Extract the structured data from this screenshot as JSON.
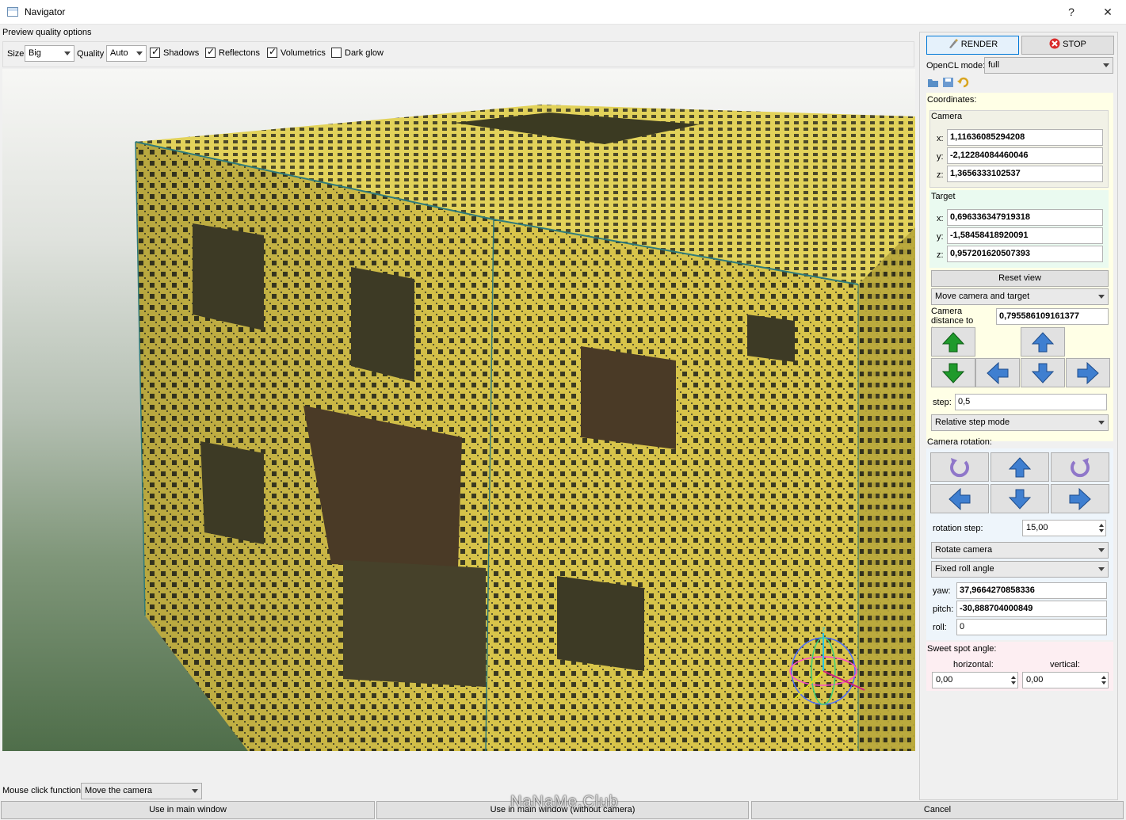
{
  "window": {
    "title": "Navigator",
    "help_label": "?",
    "close_label": "✕"
  },
  "preview": {
    "group_label": "Preview quality options",
    "size_label": "Size",
    "size_value": "Big",
    "quality_label": "Quality",
    "quality_value": "Auto",
    "shadows_label": "Shadows",
    "reflections_label": "Reflectons",
    "volumetrics_label": "Volumetrics",
    "dark_glow_label": "Dark glow",
    "shadows_checked": true,
    "reflections_checked": true,
    "volumetrics_checked": true,
    "dark_glow_checked": false
  },
  "bottom": {
    "mouse_click_label": "Mouse click function:",
    "mouse_click_value": "Move the camera",
    "use_main_window": "Use in main window",
    "use_without_camera": "Use in main window (without camera)",
    "cancel": "Cancel",
    "watermark": "NaNaMe.Club"
  },
  "panel": {
    "render_label": "RENDER",
    "stop_label": "STOP",
    "opencl_label": "OpenCL mode:",
    "opencl_value": "full",
    "coordinates_label": "Coordinates:",
    "camera_label": "Camera",
    "camera": {
      "x_label": "x:",
      "y_label": "y:",
      "z_label": "z:",
      "x": "1,11636085294208",
      "y": "-2,12284084460046",
      "z": "1,3656333102537"
    },
    "target_label": "Target",
    "target": {
      "x_label": "x:",
      "y_label": "y:",
      "z_label": "z:",
      "x": "0,696336347919318",
      "y": "-1,58458418920091",
      "z": "0,957201620507393"
    },
    "reset_view": "Reset view",
    "move_mode": "Move camera and target",
    "distance_label": "Camera distance to target:",
    "distance_value": "0,795586109161377",
    "step_label": "step:",
    "step_value": "0,5",
    "step_mode": "Relative step mode",
    "rotation_label": "Camera rotation:",
    "rotation_step_label": "rotation step:",
    "rotation_step_value": "15,00",
    "rotate_mode": "Rotate camera",
    "roll_mode": "Fixed roll angle",
    "yaw_label": "yaw:",
    "yaw_value": "37,9664270858336",
    "pitch_label": "pitch:",
    "pitch_value": "-30,888704000849",
    "roll_label": "roll:",
    "roll_value": "0",
    "sweet_spot_label": "Sweet spot angle:",
    "horizontal_label": "horizontal:",
    "vertical_label": "vertical:",
    "horizontal_value": "0,00",
    "vertical_value": "0,00"
  },
  "colors": {
    "fractal_yellow": "#d8c44a",
    "hole_dark": "#3b3a22",
    "arrow_green": "#1f9a2c",
    "arrow_blue": "#3f7fd0"
  }
}
